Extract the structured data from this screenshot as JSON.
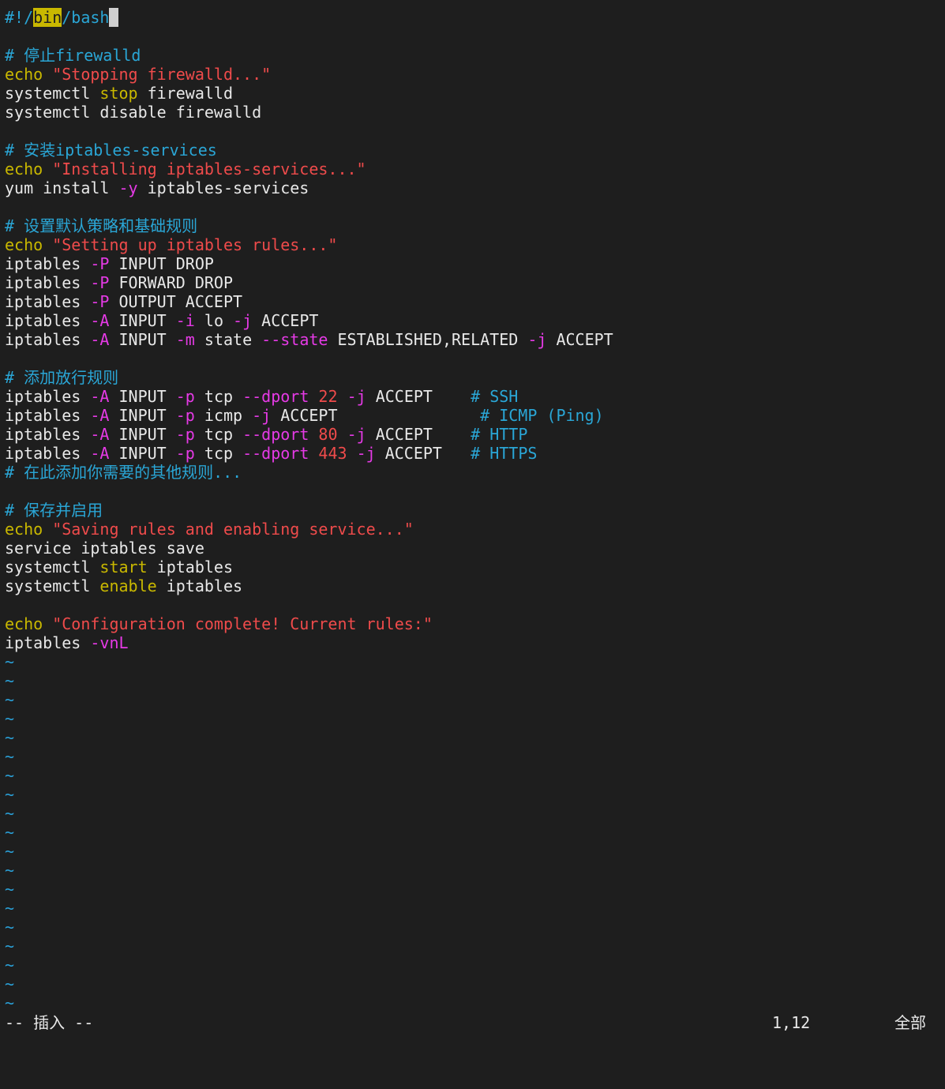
{
  "editor": {
    "colors": {
      "background": "#1e1e1e",
      "comment": "#2aa6d6",
      "keyword": "#c9b800",
      "string": "#ef4b4b",
      "flag": "#e63ae6",
      "text": "#e8e8e8",
      "tilde": "#2a9fd6"
    },
    "lines": [
      [
        {
          "t": "comment",
          "s": "#!/"
        },
        {
          "t": "highlight",
          "s": "bin"
        },
        {
          "t": "comment",
          "s": "/bash"
        },
        {
          "t": "cursor",
          "s": ""
        }
      ],
      [],
      [
        {
          "t": "comment",
          "s": "# 停止firewalld"
        }
      ],
      [
        {
          "t": "keyword",
          "s": "echo"
        },
        {
          "t": "text",
          "s": " "
        },
        {
          "t": "string",
          "s": "\"Stopping firewalld...\""
        }
      ],
      [
        {
          "t": "text",
          "s": "systemctl "
        },
        {
          "t": "keyword",
          "s": "stop"
        },
        {
          "t": "text",
          "s": " firewalld"
        }
      ],
      [
        {
          "t": "text",
          "s": "systemctl disable firewalld"
        }
      ],
      [],
      [
        {
          "t": "comment",
          "s": "# 安装iptables-services"
        }
      ],
      [
        {
          "t": "keyword",
          "s": "echo"
        },
        {
          "t": "text",
          "s": " "
        },
        {
          "t": "string",
          "s": "\"Installing iptables-services...\""
        }
      ],
      [
        {
          "t": "text",
          "s": "yum install "
        },
        {
          "t": "flag",
          "s": "-y"
        },
        {
          "t": "text",
          "s": " iptables-services"
        }
      ],
      [],
      [
        {
          "t": "comment",
          "s": "# 设置默认策略和基础规则"
        }
      ],
      [
        {
          "t": "keyword",
          "s": "echo"
        },
        {
          "t": "text",
          "s": " "
        },
        {
          "t": "string",
          "s": "\"Setting up iptables rules...\""
        }
      ],
      [
        {
          "t": "text",
          "s": "iptables "
        },
        {
          "t": "flag",
          "s": "-P"
        },
        {
          "t": "text",
          "s": " INPUT DROP"
        }
      ],
      [
        {
          "t": "text",
          "s": "iptables "
        },
        {
          "t": "flag",
          "s": "-P"
        },
        {
          "t": "text",
          "s": " FORWARD DROP"
        }
      ],
      [
        {
          "t": "text",
          "s": "iptables "
        },
        {
          "t": "flag",
          "s": "-P"
        },
        {
          "t": "text",
          "s": " OUTPUT ACCEPT"
        }
      ],
      [
        {
          "t": "text",
          "s": "iptables "
        },
        {
          "t": "flag",
          "s": "-A"
        },
        {
          "t": "text",
          "s": " INPUT "
        },
        {
          "t": "flag",
          "s": "-i"
        },
        {
          "t": "text",
          "s": " lo "
        },
        {
          "t": "flag",
          "s": "-j"
        },
        {
          "t": "text",
          "s": " ACCEPT"
        }
      ],
      [
        {
          "t": "text",
          "s": "iptables "
        },
        {
          "t": "flag",
          "s": "-A"
        },
        {
          "t": "text",
          "s": " INPUT "
        },
        {
          "t": "flag",
          "s": "-m"
        },
        {
          "t": "text",
          "s": " state "
        },
        {
          "t": "flag",
          "s": "--state"
        },
        {
          "t": "text",
          "s": " ESTABLISHED,RELATED "
        },
        {
          "t": "flag",
          "s": "-j"
        },
        {
          "t": "text",
          "s": " ACCEPT"
        }
      ],
      [],
      [
        {
          "t": "comment",
          "s": "# 添加放行规则"
        }
      ],
      [
        {
          "t": "text",
          "s": "iptables "
        },
        {
          "t": "flag",
          "s": "-A"
        },
        {
          "t": "text",
          "s": " INPUT "
        },
        {
          "t": "flag",
          "s": "-p"
        },
        {
          "t": "text",
          "s": " tcp "
        },
        {
          "t": "flag",
          "s": "--dport"
        },
        {
          "t": "text",
          "s": " "
        },
        {
          "t": "number",
          "s": "22"
        },
        {
          "t": "text",
          "s": " "
        },
        {
          "t": "flag",
          "s": "-j"
        },
        {
          "t": "text",
          "s": " ACCEPT    "
        },
        {
          "t": "comment",
          "s": "# SSH"
        }
      ],
      [
        {
          "t": "text",
          "s": "iptables "
        },
        {
          "t": "flag",
          "s": "-A"
        },
        {
          "t": "text",
          "s": " INPUT "
        },
        {
          "t": "flag",
          "s": "-p"
        },
        {
          "t": "text",
          "s": " icmp "
        },
        {
          "t": "flag",
          "s": "-j"
        },
        {
          "t": "text",
          "s": " ACCEPT               "
        },
        {
          "t": "comment",
          "s": "# ICMP (Ping)"
        }
      ],
      [
        {
          "t": "text",
          "s": "iptables "
        },
        {
          "t": "flag",
          "s": "-A"
        },
        {
          "t": "text",
          "s": " INPUT "
        },
        {
          "t": "flag",
          "s": "-p"
        },
        {
          "t": "text",
          "s": " tcp "
        },
        {
          "t": "flag",
          "s": "--dport"
        },
        {
          "t": "text",
          "s": " "
        },
        {
          "t": "number",
          "s": "80"
        },
        {
          "t": "text",
          "s": " "
        },
        {
          "t": "flag",
          "s": "-j"
        },
        {
          "t": "text",
          "s": " ACCEPT    "
        },
        {
          "t": "comment",
          "s": "# HTTP"
        }
      ],
      [
        {
          "t": "text",
          "s": "iptables "
        },
        {
          "t": "flag",
          "s": "-A"
        },
        {
          "t": "text",
          "s": " INPUT "
        },
        {
          "t": "flag",
          "s": "-p"
        },
        {
          "t": "text",
          "s": " tcp "
        },
        {
          "t": "flag",
          "s": "--dport"
        },
        {
          "t": "text",
          "s": " "
        },
        {
          "t": "number",
          "s": "443"
        },
        {
          "t": "text",
          "s": " "
        },
        {
          "t": "flag",
          "s": "-j"
        },
        {
          "t": "text",
          "s": " ACCEPT   "
        },
        {
          "t": "comment",
          "s": "# HTTPS"
        }
      ],
      [
        {
          "t": "comment",
          "s": "# 在此添加你需要的其他规则..."
        }
      ],
      [],
      [
        {
          "t": "comment",
          "s": "# 保存并启用"
        }
      ],
      [
        {
          "t": "keyword",
          "s": "echo"
        },
        {
          "t": "text",
          "s": " "
        },
        {
          "t": "string",
          "s": "\"Saving rules and enabling service...\""
        }
      ],
      [
        {
          "t": "text",
          "s": "service iptables save"
        }
      ],
      [
        {
          "t": "text",
          "s": "systemctl "
        },
        {
          "t": "keyword",
          "s": "start"
        },
        {
          "t": "text",
          "s": " iptables"
        }
      ],
      [
        {
          "t": "text",
          "s": "systemctl "
        },
        {
          "t": "keyword",
          "s": "enable"
        },
        {
          "t": "text",
          "s": " iptables"
        }
      ],
      [],
      [
        {
          "t": "keyword",
          "s": "echo"
        },
        {
          "t": "text",
          "s": " "
        },
        {
          "t": "string",
          "s": "\"Configuration complete! Current rules:\""
        }
      ],
      [
        {
          "t": "text",
          "s": "iptables "
        },
        {
          "t": "flag",
          "s": "-vnL"
        }
      ]
    ],
    "tilde_char": "~",
    "tilde_count": 19
  },
  "statusbar": {
    "mode": "-- 插入 --",
    "position": "1,12",
    "scroll": "全部"
  }
}
